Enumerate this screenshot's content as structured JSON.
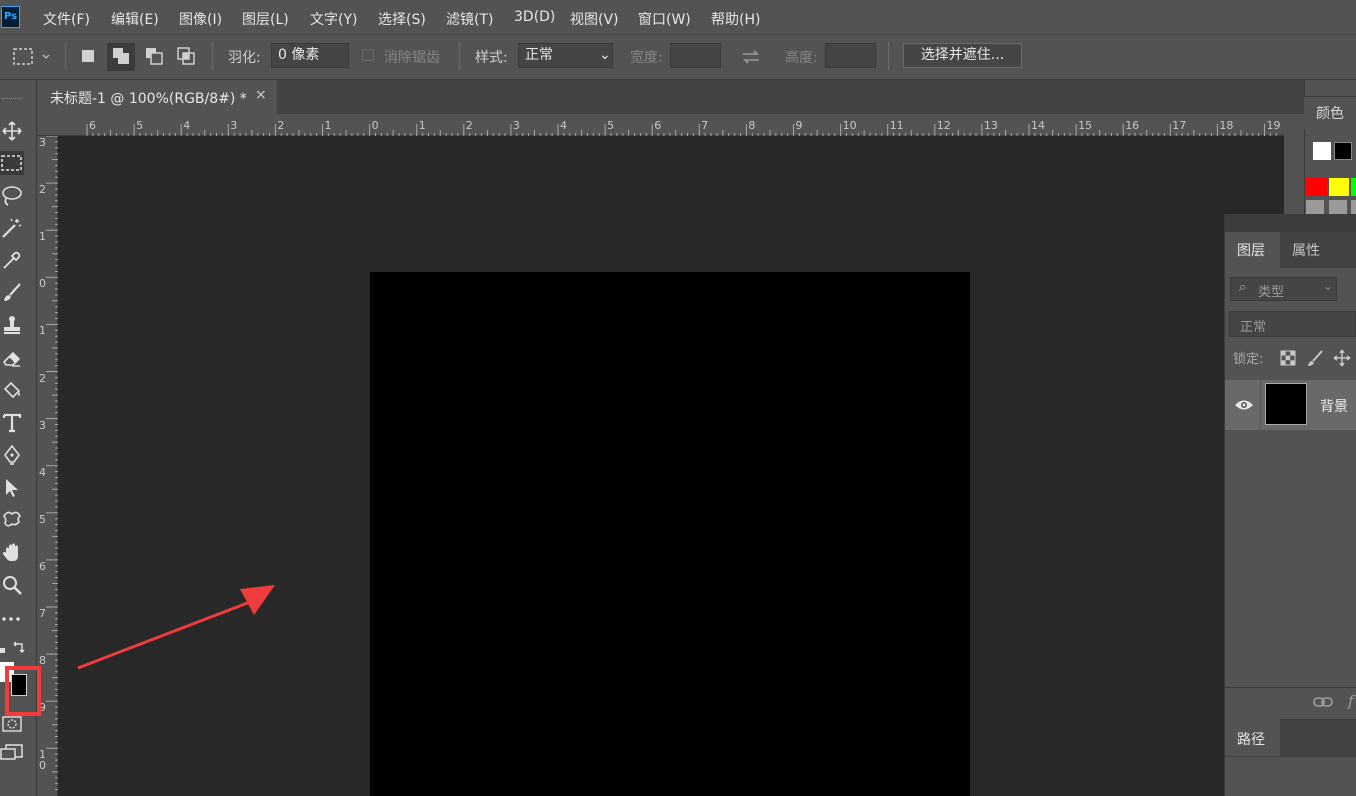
{
  "app": {
    "logo_text": "Ps"
  },
  "menu": [
    "文件(F)",
    "编辑(E)",
    "图像(I)",
    "图层(L)",
    "文字(Y)",
    "选择(S)",
    "滤镜(T)",
    "3D(D)",
    "视图(V)",
    "窗口(W)",
    "帮助(H)"
  ],
  "options": {
    "feather_label": "羽化:",
    "feather_value": "0 像素",
    "antialias_label": "消除锯齿",
    "style_label": "样式:",
    "style_value": "正常",
    "width_label": "宽度:",
    "height_label": "高度:",
    "select_mask_button": "选择并遮住..."
  },
  "document": {
    "tab_label": "未标题-1 @ 100%(RGB/8#) *",
    "close_glyph": "×"
  },
  "rulers": {
    "horizontal": [
      "6",
      "5",
      "4",
      "3",
      "2",
      "1",
      "0",
      "1",
      "2",
      "3",
      "4",
      "5",
      "6",
      "7",
      "8",
      "9",
      "10",
      "11",
      "12",
      "13",
      "14",
      "15",
      "16",
      "17",
      "18",
      "19"
    ],
    "vertical": [
      "3",
      "2",
      "1",
      "0",
      "1",
      "2",
      "3",
      "4",
      "5",
      "6",
      "7",
      "8",
      "9",
      "10"
    ]
  },
  "panels": {
    "color_tab": "颜色",
    "layers_tab": "图层",
    "properties_tab": "属性",
    "filter_placeholder": "类型",
    "blend_mode": "正常",
    "lock_label": "锁定:",
    "layer_name": "背景",
    "paths_tab": "路径"
  },
  "colors": {
    "background": "#535353",
    "workspace": "#282828",
    "canvas": "#000000",
    "annotation": "#f03c3c",
    "swatches": [
      "#ffffff",
      "#000000",
      "#ff0000",
      "#ffff00",
      "#00ff00"
    ]
  }
}
